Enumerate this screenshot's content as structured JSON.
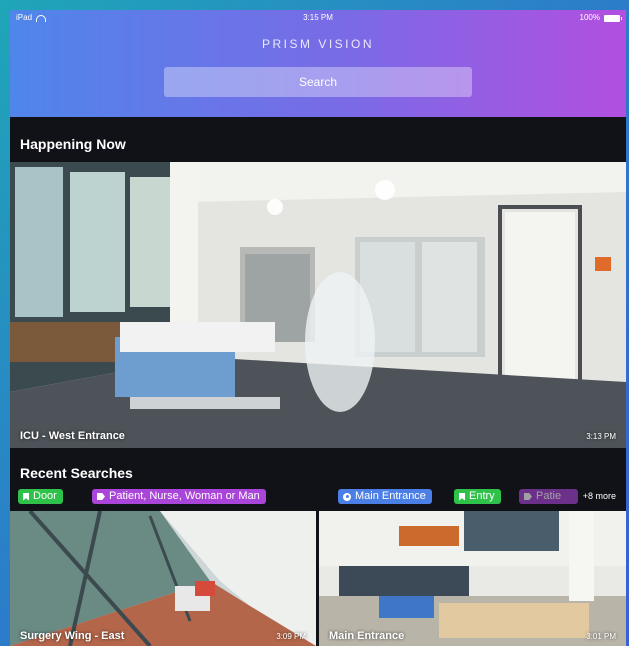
{
  "status": {
    "device": "iPad",
    "time": "3:15 PM",
    "battery": "100%"
  },
  "header": {
    "brand": "PRISM VISION",
    "search_label": "Search"
  },
  "happening_now": {
    "title": "Happening Now",
    "camera": {
      "label": "ICU - West Entrance",
      "time": "3:13 PM"
    }
  },
  "recent_searches": {
    "title": "Recent Searches",
    "chips": [
      {
        "label": "Door",
        "icon": "bookmark-icon",
        "color": "#2ec24a"
      },
      {
        "label": "Patient, Nurse, Woman or Man",
        "icon": "tag-icon",
        "color": "#a945d8"
      },
      {
        "label": "Main Entrance",
        "icon": "location-icon",
        "color": "#4c7fe6"
      },
      {
        "label": "Entry",
        "icon": "bookmark-icon",
        "color": "#2ec24a"
      },
      {
        "label": "Patie",
        "icon": "tag-icon",
        "color": "#a945d8"
      }
    ],
    "more": "+8 more",
    "results": [
      {
        "label": "Surgery Wing - East",
        "time": "3:09 PM"
      },
      {
        "label": "Main Entrance",
        "time": "3:01 PM"
      }
    ]
  }
}
